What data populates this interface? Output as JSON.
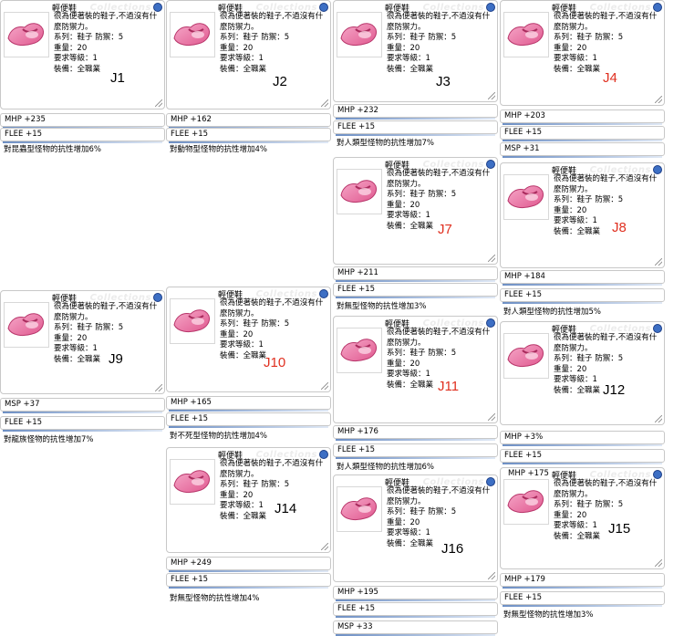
{
  "common": {
    "item_name": "輕便鞋",
    "watermark": "Collections",
    "desc_line1": "很為便著裝的鞋子,不過沒有什",
    "desc_line2": "麼防禦力。",
    "desc_type": "系列：鞋子  防禦：5",
    "desc_weight": "重量：20",
    "desc_level": "要求等級：1",
    "desc_equip": "裝備：全職業"
  },
  "colors": {
    "tag_black": "#000000",
    "tag_red": "#e03020"
  },
  "cards": [
    {
      "tag": "J1",
      "tag_color": "black",
      "stats": [
        "MHP +235",
        "FLEE +15",
        "對昆蟲型怪物的抗性增加6%"
      ]
    },
    {
      "tag": "J2",
      "tag_color": "black",
      "stats": [
        "MHP +162",
        "FLEE +15",
        "對動物型怪物的抗性增加4%"
      ]
    },
    {
      "tag": "J3",
      "tag_color": "black",
      "stats": [
        "MHP +232",
        "FLEE +15",
        "對人類型怪物的抗性增加7%"
      ]
    },
    {
      "tag": "J4",
      "tag_color": "red",
      "stats": [
        "MHP +203",
        "FLEE +15",
        "MSP +31"
      ]
    },
    {
      "tag": "J7",
      "tag_color": "red",
      "stats": [
        "MHP +211",
        "FLEE +15",
        "對無型怪物的抗性增加3%"
      ]
    },
    {
      "tag": "J8",
      "tag_color": "red",
      "stats": [
        "MHP +184",
        "FLEE +15",
        "對人類型怪物的抗性增加5%"
      ]
    },
    {
      "tag": "J9",
      "tag_color": "black",
      "stats": [
        "MSP +37",
        "FLEE +15",
        "對龍族怪物的抗性增加7%"
      ]
    },
    {
      "tag": "J10",
      "tag_color": "red",
      "stats": [
        "MHP +165",
        "FLEE +15",
        "對不死型怪物的抗性增加4%"
      ]
    },
    {
      "tag": "J11",
      "tag_color": "red",
      "stats": [
        "MHP +176",
        "FLEE +15",
        "對人類型怪物的抗性增加6%"
      ]
    },
    {
      "tag": "J12",
      "tag_color": "black",
      "stats": [
        "MHP +3%",
        "FLEE +15"
      ]
    },
    {
      "tag": "J14",
      "tag_color": "black",
      "stats": [
        "MHP +249",
        "FLEE +15",
        "對無型怪物的抗性增加4%"
      ]
    },
    {
      "tag": "J16",
      "tag_color": "black",
      "stats": [
        "MHP +195",
        "FLEE +15",
        "MSP +33"
      ]
    },
    {
      "tag": "J15",
      "tag_color": "black",
      "stats": [
        "MHP +175",
        "MHP +179",
        "FLEE +15",
        "對無型怪物的抗性增加3%"
      ]
    }
  ]
}
